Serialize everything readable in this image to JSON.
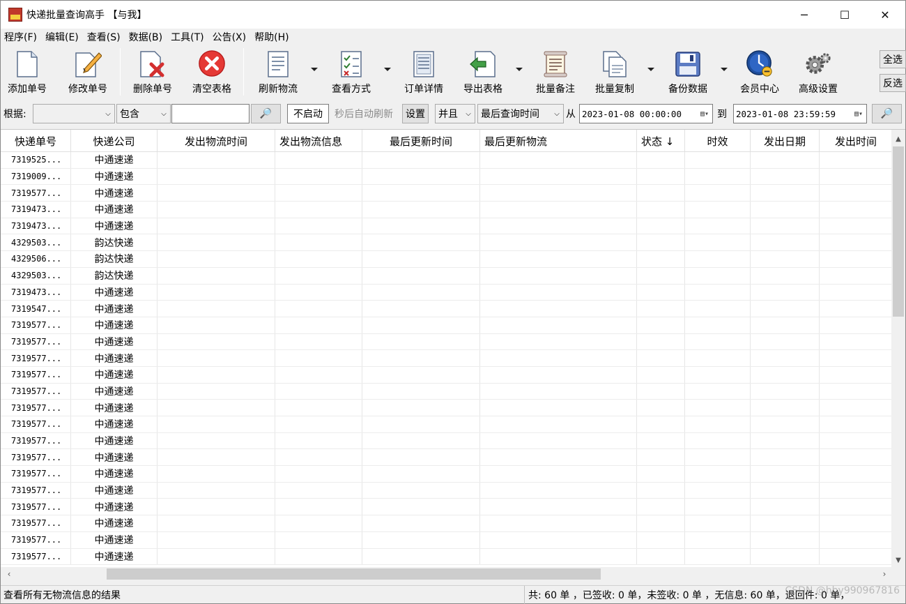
{
  "window": {
    "title": "快递批量查询高手 【与我】",
    "min_label": "─",
    "max_label": "☐",
    "close_label": "✕"
  },
  "menu": [
    "程序(F)",
    "编辑(E)",
    "查看(S)",
    "数据(B)",
    "工具(T)",
    "公告(X)",
    "帮助(H)"
  ],
  "toolbar": {
    "add": "添加单号",
    "edit": "修改单号",
    "delete": "删除单号",
    "clear": "清空表格",
    "refresh": "刷新物流",
    "view_mode": "查看方式",
    "order_detail": "订单详情",
    "export": "导出表格",
    "batch_note": "批量备注",
    "batch_copy": "批量复制",
    "backup": "备份数据",
    "member": "会员中心",
    "advanced": "高级设置",
    "select_all": "全选",
    "invert": "反选"
  },
  "filter": {
    "basis_label": "根据:",
    "basis_value": "",
    "contains_value": "包含",
    "search_value": "",
    "search_icon": "🔎",
    "auto_toggle": "不启动",
    "auto_label": "秒后自动刷新",
    "settings": "设置",
    "logic_value": "并且",
    "time_field": "最后查询时间",
    "from_label": "从",
    "from_date": "2023-01-08 00:00:00",
    "to_label": "到",
    "to_date": "2023-01-08 23:59:59"
  },
  "columns": [
    "快递单号",
    "快递公司",
    "发出物流时间",
    "发出物流信息",
    "最后更新时间",
    "最后更新物流",
    "状态 ↓",
    "时效",
    "发出日期",
    "发出时间"
  ],
  "rows": [
    {
      "no": "7319525...",
      "company": "中通速递"
    },
    {
      "no": "7319009...",
      "company": "中通速递"
    },
    {
      "no": "7319577...",
      "company": "中通速递"
    },
    {
      "no": "7319473...",
      "company": "中通速递"
    },
    {
      "no": "7319473...",
      "company": "中通速递"
    },
    {
      "no": "4329503...",
      "company": "韵达快递"
    },
    {
      "no": "4329506...",
      "company": "韵达快递"
    },
    {
      "no": "4329503...",
      "company": "韵达快递"
    },
    {
      "no": "7319473...",
      "company": "中通速递"
    },
    {
      "no": "7319547...",
      "company": "中通速递"
    },
    {
      "no": "7319577...",
      "company": "中通速递"
    },
    {
      "no": "7319577...",
      "company": "中通速递"
    },
    {
      "no": "7319577...",
      "company": "中通速递"
    },
    {
      "no": "7319577...",
      "company": "中通速递"
    },
    {
      "no": "7319577...",
      "company": "中通速递"
    },
    {
      "no": "7319577...",
      "company": "中通速递"
    },
    {
      "no": "7319577...",
      "company": "中通速递"
    },
    {
      "no": "7319577...",
      "company": "中通速递"
    },
    {
      "no": "7319577...",
      "company": "中通速递"
    },
    {
      "no": "7319577...",
      "company": "中通速递"
    },
    {
      "no": "7319577...",
      "company": "中通速递"
    },
    {
      "no": "7319577...",
      "company": "中通速递"
    },
    {
      "no": "7319577...",
      "company": "中通速递"
    },
    {
      "no": "7319577...",
      "company": "中通速递"
    },
    {
      "no": "7319577...",
      "company": "中通速递"
    }
  ],
  "status": {
    "left": "查看所有无物流信息的结果",
    "right": "共: 60 单 ，已签收: 0 单，未签收: 0 单 ，无信息: 60 单，退回件: 0 单，",
    "watermark": "CSDN @hby990967816"
  }
}
